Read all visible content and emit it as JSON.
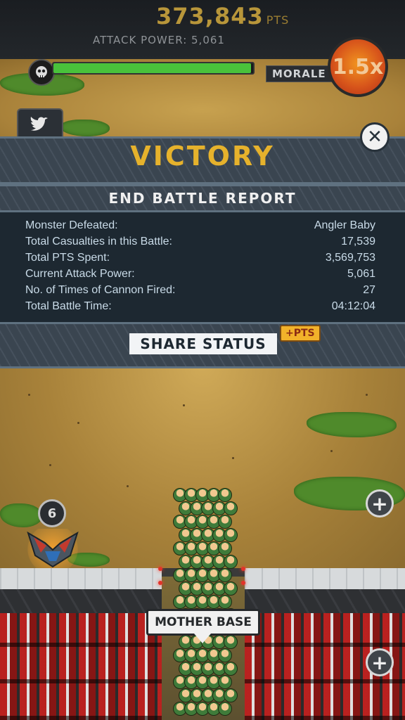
{
  "hud": {
    "score": "373,843",
    "score_unit": "PTS",
    "attack_power": "ATTACK POWER: 5,061",
    "morale_label": "MORALE",
    "multiplier": "1.5x",
    "boss_hp_fraction": 0.99
  },
  "icons": {
    "boss": "skull-icon",
    "twitter": "twitter-bird-icon",
    "close": "close-icon"
  },
  "victory": {
    "title": "VICTORY"
  },
  "report": {
    "heading": "END BATTLE REPORT",
    "rows": [
      {
        "label": "Monster Defeated:",
        "value": "Angler Baby"
      },
      {
        "label": "Total Casualties in this Battle:",
        "value": "17,539"
      },
      {
        "label": "Total PTS Spent:",
        "value": "3,569,753"
      },
      {
        "label": "Current Attack Power:",
        "value": "5,061"
      },
      {
        "label": "No. of Times of Cannon Fired:",
        "value": "27"
      },
      {
        "label": "Total Battle Time:",
        "value": "04:12:04"
      }
    ],
    "share_label": "SHARE STATUS",
    "share_bonus": "+PTS"
  },
  "battlefield": {
    "unit_count": "6",
    "base_label": "MOTHER BASE",
    "plus_symbol": "+"
  },
  "colors": {
    "accent_gold": "#e6b22c",
    "panel_bg": "#1d2831",
    "hp_green": "#49c23b",
    "multiplier_orange": "#d8561b"
  }
}
